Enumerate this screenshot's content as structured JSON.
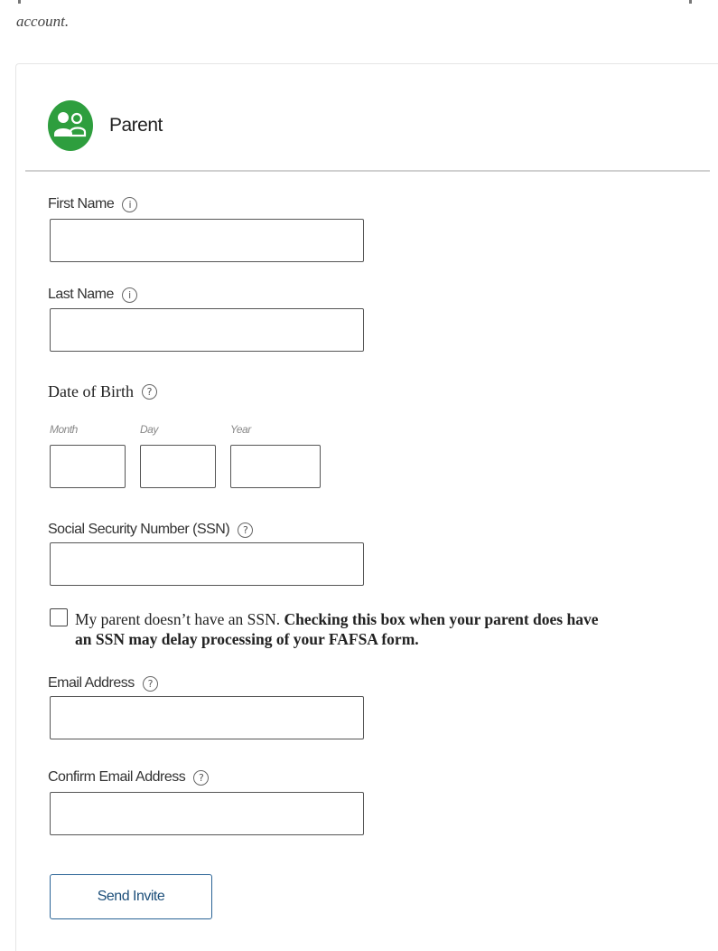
{
  "intro": {
    "text": "account."
  },
  "section": {
    "title": "Parent",
    "icon": "parent-people-icon"
  },
  "fields": {
    "first_name": {
      "label": "First Name",
      "help_icon": "info-icon",
      "help_glyph": "i",
      "value": ""
    },
    "last_name": {
      "label": "Last Name",
      "help_icon": "info-icon",
      "help_glyph": "i",
      "value": ""
    },
    "dob": {
      "label": "Date of Birth",
      "help_icon": "question-icon",
      "help_glyph": "?",
      "month_label": "Month",
      "day_label": "Day",
      "year_label": "Year",
      "month": "",
      "day": "",
      "year": ""
    },
    "ssn": {
      "label": "Social Security Number (SSN)",
      "help_icon": "question-icon",
      "help_glyph": "?",
      "value": ""
    },
    "no_ssn": {
      "text": "My parent doesn’t have an SSN.",
      "bold_text": "Checking this box when your parent does have an SSN may delay processing of your FAFSA form.",
      "checked": false
    },
    "email": {
      "label": "Email Address",
      "help_icon": "question-icon",
      "help_glyph": "?",
      "value": ""
    },
    "confirm_email": {
      "label": "Confirm Email Address",
      "help_icon": "question-icon",
      "help_glyph": "?",
      "value": ""
    }
  },
  "actions": {
    "send_invite": "Send Invite"
  },
  "colors": {
    "accent_green": "#2e9e3e",
    "button_blue": "#1d4f7a"
  }
}
